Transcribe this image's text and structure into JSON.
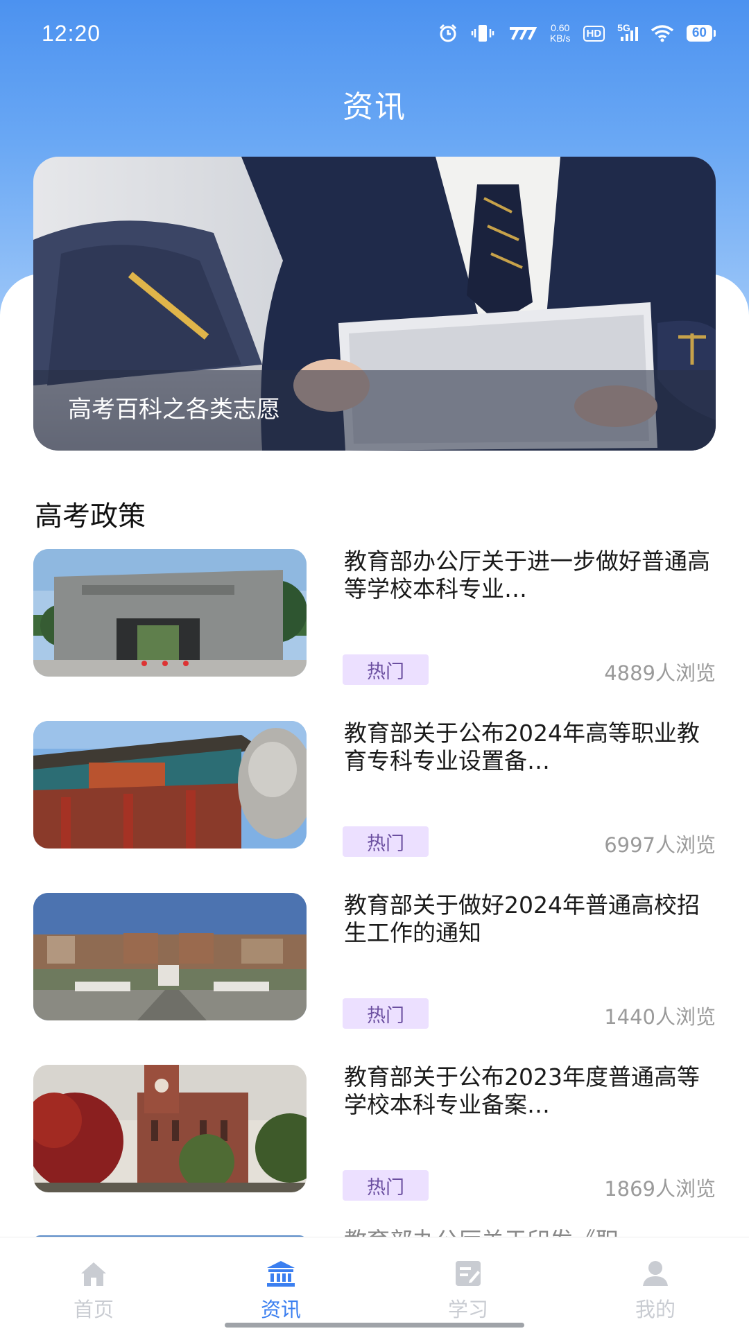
{
  "status_bar": {
    "time": "12:20",
    "net_speed_value": "0.60",
    "net_speed_unit": "KB/s",
    "hd": "HD",
    "signal_label": "5G",
    "battery": "60"
  },
  "header": {
    "title": "资讯"
  },
  "banner": {
    "caption": "高考百科之各类志愿"
  },
  "section": {
    "title": "高考政策"
  },
  "news": [
    {
      "title": "教育部办公厅关于进一步做好普通高等学校本科专业…",
      "tag": "热门",
      "views": "4889人浏览"
    },
    {
      "title": "教育部关于公布2024年高等职业教育专科专业设置备…",
      "tag": "热门",
      "views": "6997人浏览"
    },
    {
      "title": "教育部关于做好2024年普通高校招生工作的通知",
      "tag": "热门",
      "views": "1440人浏览"
    },
    {
      "title": "教育部关于公布2023年度普通高等学校本科专业备案…",
      "tag": "热门",
      "views": "1869人浏览"
    }
  ],
  "partial_item": {
    "title": "教育部办公厅关于印发《职"
  },
  "tab_bar": {
    "items": [
      {
        "label": "首页",
        "icon": "home-icon"
      },
      {
        "label": "资讯",
        "icon": "bank-icon"
      },
      {
        "label": "学习",
        "icon": "edit-icon"
      },
      {
        "label": "我的",
        "icon": "user-icon"
      }
    ],
    "active_color": "#3b7ff0",
    "inactive_color": "#c9ccd2"
  },
  "colors": {
    "header_blue": "#4c92f0",
    "tag_bg": "#ece0ff",
    "tag_text": "#6b4fa0"
  }
}
